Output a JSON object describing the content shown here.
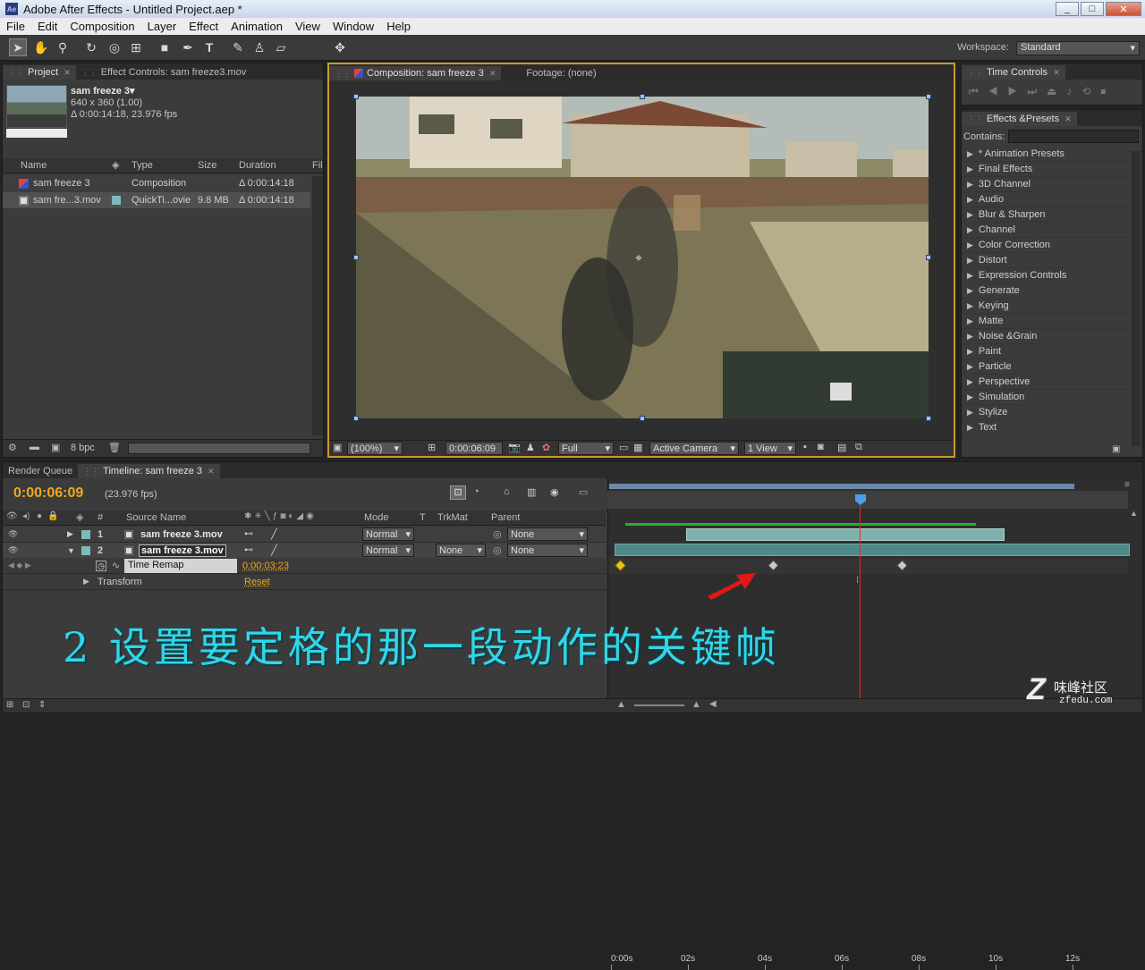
{
  "window": {
    "title": "Adobe After Effects - Untitled Project.aep *",
    "app_icon": "ae-app-icon",
    "min": "_",
    "max": "□",
    "close": "✕"
  },
  "menu": [
    "File",
    "Edit",
    "Composition",
    "Layer",
    "Effect",
    "Animation",
    "View",
    "Window",
    "Help"
  ],
  "tools": [
    "selection-tool",
    "hand-tool",
    "zoom-tool",
    "rotate-tool",
    "orbit-camera-tool",
    "pan-behind-tool",
    "rectangle-tool",
    "pen-tool",
    "type-tool",
    "brush-tool",
    "clone-stamp-tool",
    "eraser-tool",
    "puppet-tool"
  ],
  "workspace": {
    "label": "Workspace:",
    "value": "Standard"
  },
  "project_panel": {
    "tabs": [
      "Project",
      "Effect Controls: sam freeze3.mov"
    ],
    "item_name": "sam freeze 3▾",
    "item_line1": "640 x 360 (1.00)",
    "item_line2": "Δ 0:00:14:18, 23.976 fps",
    "columns": [
      "Name",
      "Type",
      "Size",
      "Duration",
      "Fil"
    ],
    "rows": [
      {
        "name": "sam freeze 3",
        "type": "Composition",
        "size": "",
        "duration": "Δ 0:00:14:18"
      },
      {
        "name": "sam fre...3.mov",
        "type": "QuickTi...ovie",
        "size": "9.8 MB",
        "duration": "Δ 0:00:14:18"
      }
    ],
    "bpc": "8 bpc"
  },
  "comp_panel": {
    "tabs": [
      "Composition: sam freeze 3",
      "Footage: (none)"
    ],
    "zoom": "(100%)",
    "timecode": "0:00:06:09",
    "resolution": "Full",
    "camera": "Active Camera",
    "views": "1 View"
  },
  "time_controls": {
    "tab": "Time Controls"
  },
  "effects_panel": {
    "tab": "Effects &Presets",
    "contains_label": "Contains:",
    "items": [
      "* Animation Presets",
      "Final Effects",
      "3D Channel",
      "Audio",
      "Blur & Sharpen",
      "Channel",
      "Color Correction",
      "Distort",
      "Expression Controls",
      "Generate",
      "Keying",
      "Matte",
      "Noise &Grain",
      "Paint",
      "Particle",
      "Perspective",
      "Simulation",
      "Stylize",
      "Text"
    ]
  },
  "timeline": {
    "tabs": [
      "Render Queue",
      "Timeline: sam freeze 3"
    ],
    "current_time": "0:00:06:09",
    "fps": "(23.976 fps)",
    "columns": {
      "num": "#",
      "source": "Source Name",
      "mode": "Mode",
      "t": "T",
      "trkmat": "TrkMat",
      "parent": "Parent"
    },
    "layers": [
      {
        "num": "1",
        "name": "sam freeze 3.mov",
        "mode": "Normal",
        "trkmat": "",
        "parent": "None"
      },
      {
        "num": "2",
        "name": "sam freeze 3.mov",
        "mode": "Normal",
        "trkmat": "None",
        "parent": "None"
      }
    ],
    "time_remap": {
      "label": "Time Remap",
      "value": "0:00:03:23"
    },
    "transform": {
      "label": "Transform",
      "value": "Reset"
    },
    "ruler": [
      "0:00s",
      "02s",
      "04s",
      "06s",
      "08s",
      "10s",
      "12s"
    ],
    "playhead_seconds": 6.4
  },
  "caption": "2 设置要定格的那一段动作的关键帧",
  "watermark": {
    "brand": "Z",
    "text": "味峰社区",
    "url": "zfedu.com"
  },
  "colors": {
    "accent": "#f0a818",
    "caption": "#30d6e8",
    "playhead": "#d43030",
    "layer_bar": "#4f8a88"
  }
}
